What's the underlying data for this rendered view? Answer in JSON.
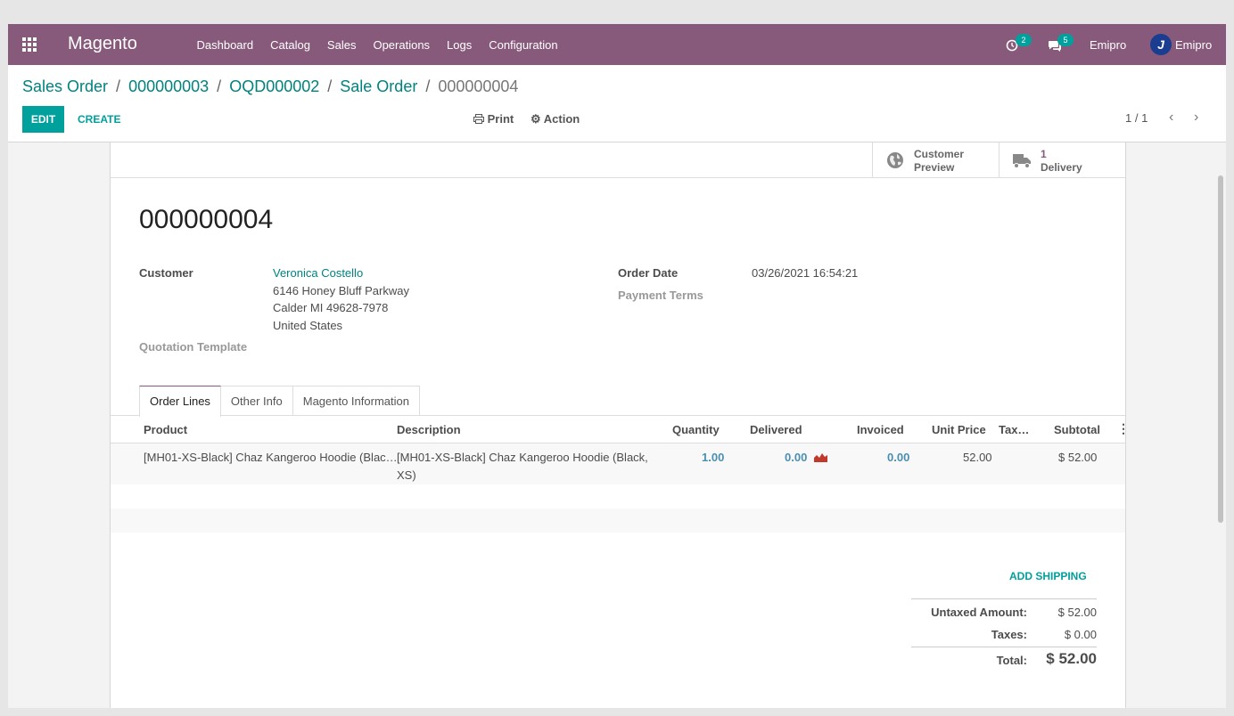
{
  "navbar": {
    "brand": "Magento",
    "menu": [
      "Dashboard",
      "Catalog",
      "Sales",
      "Operations",
      "Logs",
      "Configuration"
    ],
    "activity_count": "2",
    "messages_count": "5",
    "company": "Emipro",
    "user": "Emipro",
    "color": "#875a7b"
  },
  "breadcrumb": {
    "items": [
      "Sales Order",
      "000000003",
      "OQD000002",
      "Sale Order"
    ],
    "current": "000000004"
  },
  "toolbar": {
    "edit_label": "EDIT",
    "create_label": "CREATE",
    "print_label": "Print",
    "action_label": "Action",
    "pager": "1 / 1"
  },
  "smart_buttons": {
    "customer_preview_line1": "Customer",
    "customer_preview_line2": "Preview",
    "delivery_count": "1",
    "delivery_label": "Delivery"
  },
  "form": {
    "title": "000000004",
    "customer_label": "Customer",
    "customer_name": "Veronica Costello",
    "address_line1": "6146 Honey Bluff Parkway",
    "address_line2": "Calder MI 49628-7978",
    "address_line3": "United States",
    "quotation_template_label": "Quotation Template",
    "order_date_label": "Order Date",
    "order_date": "03/26/2021 16:54:21",
    "payment_terms_label": "Payment Terms"
  },
  "tabs": [
    "Order Lines",
    "Other Info",
    "Magento Information"
  ],
  "order_lines": {
    "headers": {
      "product": "Product",
      "description": "Description",
      "quantity": "Quantity",
      "delivered": "Delivered",
      "invoiced": "Invoiced",
      "unit_price": "Unit Price",
      "taxes": "Tax…",
      "subtotal": "Subtotal"
    },
    "rows": [
      {
        "product": "[MH01-XS-Black] Chaz Kangeroo Hoodie (Blac…",
        "description_line1": "[MH01-XS-Black] Chaz Kangeroo Hoodie (Black,",
        "description_line2": "XS)",
        "quantity": "1.00",
        "delivered": "0.00",
        "invoiced": "0.00",
        "unit_price": "52.00",
        "subtotal": "$ 52.00"
      }
    ]
  },
  "totals": {
    "add_shipping_label": "ADD SHIPPING",
    "untaxed_label": "Untaxed Amount:",
    "untaxed_value": "$ 52.00",
    "taxes_label": "Taxes:",
    "taxes_value": "$ 0.00",
    "total_label": "Total:",
    "total_value": "$ 52.00"
  }
}
